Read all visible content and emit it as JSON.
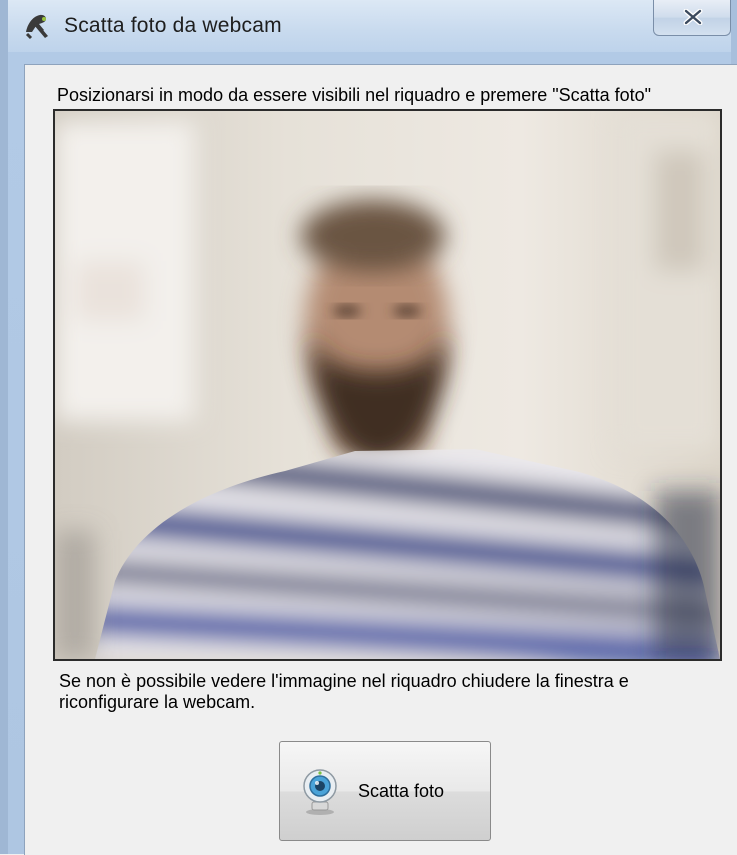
{
  "window": {
    "title": "Scatta foto da webcam",
    "icon": "app-logo-icon",
    "close_icon": "close-icon"
  },
  "content": {
    "instruction": "Posizionarsi in modo da essere visibili nel riquadro e premere \"Scatta foto\"",
    "bottom_note": "Se non è possibile vedere l'immagine nel riquadro chiudere la finestra e riconfigurare la webcam.",
    "snap_button": {
      "label": "Scatta foto",
      "icon": "webcam-icon"
    }
  },
  "colors": {
    "title_bar": "#c8daee",
    "dialog_background": "#f0f0f0",
    "preview_border": "#2b2b2b"
  }
}
